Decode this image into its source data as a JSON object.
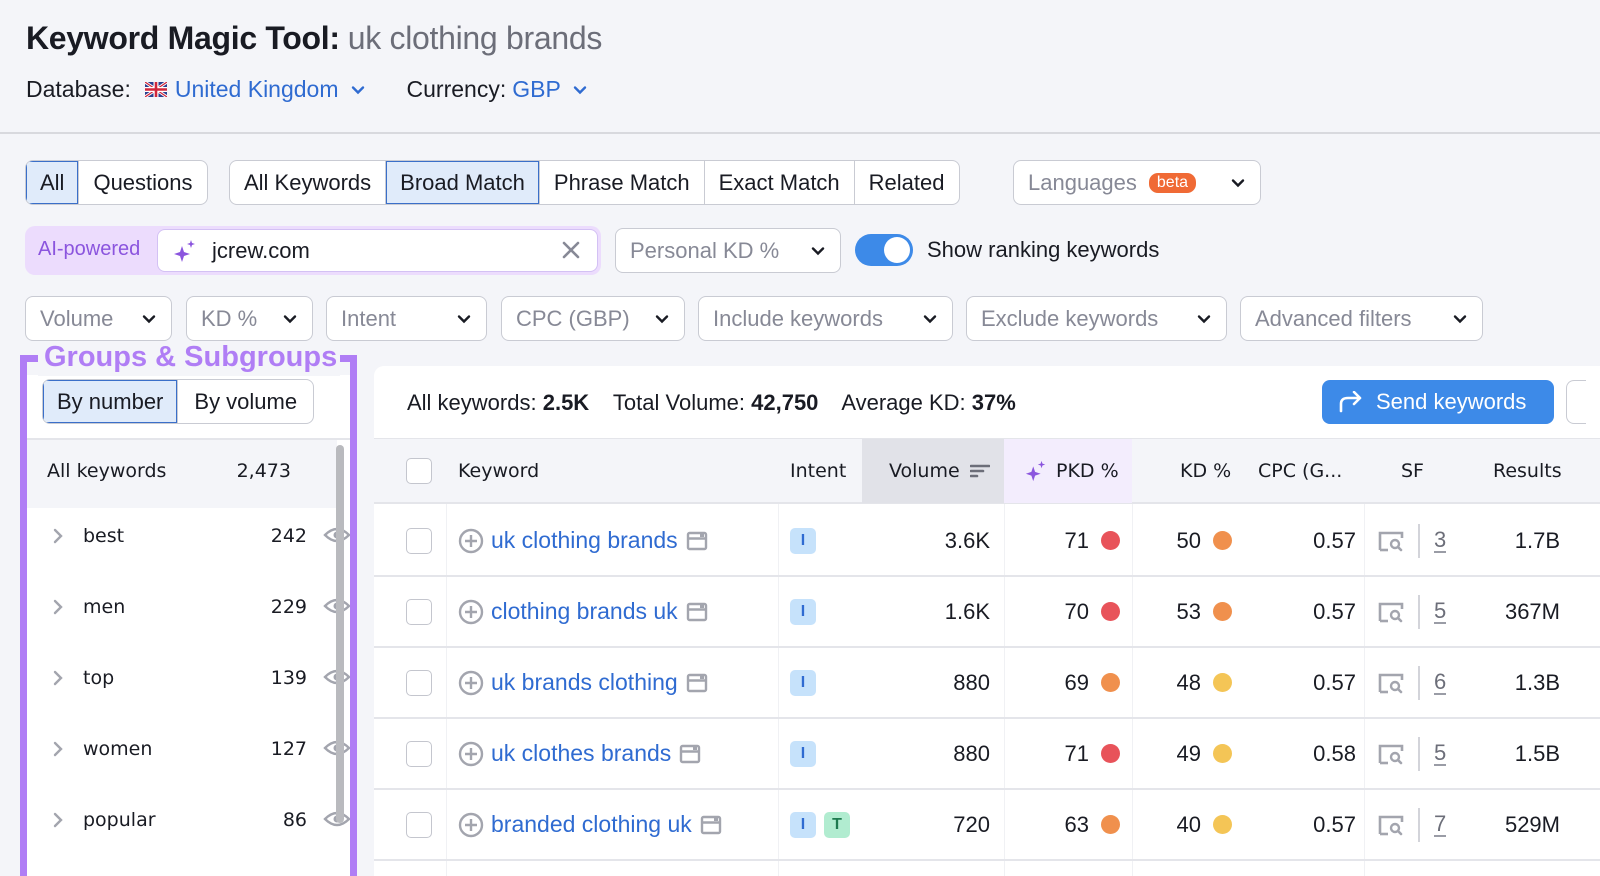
{
  "header": {
    "tool_name": "Keyword Magic Tool:",
    "query": "uk clothing brands",
    "database_label": "Database:",
    "database_value": "United Kingdom",
    "database_flag": "uk-flag-icon",
    "currency_label": "Currency:",
    "currency_value": "GBP"
  },
  "type_tabs": [
    {
      "label": "All",
      "active": true
    },
    {
      "label": "Questions",
      "active": false
    }
  ],
  "match_tabs": [
    {
      "label": "All Keywords",
      "active": false
    },
    {
      "label": "Broad Match",
      "active": true
    },
    {
      "label": "Phrase Match",
      "active": false
    },
    {
      "label": "Exact Match",
      "active": false
    },
    {
      "label": "Related",
      "active": false
    }
  ],
  "languages": {
    "label": "Languages",
    "badge": "beta"
  },
  "ai": {
    "label": "AI-powered",
    "domain_value": "jcrew.com",
    "personal_kd_label": "Personal KD %",
    "toggle_label": "Show ranking keywords",
    "toggle_on": true
  },
  "filters": [
    "Volume",
    "KD %",
    "Intent",
    "CPC (GBP)",
    "Include keywords",
    "Exclude keywords",
    "Advanced filters"
  ],
  "groups": {
    "title": "Groups & Subgroups",
    "sort_tabs": [
      {
        "label": "By number",
        "active": true
      },
      {
        "label": "By volume",
        "active": false
      }
    ],
    "all_label": "All keywords",
    "all_count": "2,473",
    "items": [
      {
        "name": "best",
        "count": "242"
      },
      {
        "name": "men",
        "count": "229"
      },
      {
        "name": "top",
        "count": "139"
      },
      {
        "name": "women",
        "count": "127"
      },
      {
        "name": "popular",
        "count": "86"
      }
    ]
  },
  "summary": {
    "all_keywords_label": "All keywords:",
    "all_keywords_value": "2.5K",
    "total_volume_label": "Total Volume:",
    "total_volume_value": "42,750",
    "avg_kd_label": "Average KD:",
    "avg_kd_value": "37%",
    "send_button": "Send keywords"
  },
  "table": {
    "columns": {
      "keyword": "Keyword",
      "intent": "Intent",
      "volume": "Volume",
      "pkd": "PKD %",
      "kd": "KD %",
      "cpc": "CPC (G...",
      "sf": "SF",
      "results": "Results"
    },
    "rows": [
      {
        "keyword": "uk clothing brands",
        "intents": [
          "I"
        ],
        "volume": "3.6K",
        "pkd": "71",
        "pkd_color": "#e8535a",
        "kd": "50",
        "kd_color": "#f0904d",
        "cpc": "0.57",
        "sf": "3",
        "results": "1.7B"
      },
      {
        "keyword": "clothing brands uk",
        "intents": [
          "I"
        ],
        "volume": "1.6K",
        "pkd": "70",
        "pkd_color": "#e8535a",
        "kd": "53",
        "kd_color": "#f0904d",
        "cpc": "0.57",
        "sf": "5",
        "results": "367M"
      },
      {
        "keyword": "uk brands clothing",
        "intents": [
          "I"
        ],
        "volume": "880",
        "pkd": "69",
        "pkd_color": "#f0904d",
        "kd": "48",
        "kd_color": "#f4c556",
        "cpc": "0.57",
        "sf": "6",
        "results": "1.3B"
      },
      {
        "keyword": "uk clothes brands",
        "intents": [
          "I"
        ],
        "volume": "880",
        "pkd": "71",
        "pkd_color": "#e8535a",
        "kd": "49",
        "kd_color": "#f4c556",
        "cpc": "0.58",
        "sf": "5",
        "results": "1.5B"
      },
      {
        "keyword": "branded clothing uk",
        "intents": [
          "I",
          "T"
        ],
        "volume": "720",
        "pkd": "63",
        "pkd_color": "#f0904d",
        "kd": "40",
        "kd_color": "#f4c556",
        "cpc": "0.57",
        "sf": "7",
        "results": "529M"
      }
    ]
  },
  "colors": {
    "accent_blue": "#3d8ae8",
    "link_blue": "#2f6bd1",
    "highlight_purple": "#b07ef5",
    "beta_orange": "#f06a35"
  }
}
